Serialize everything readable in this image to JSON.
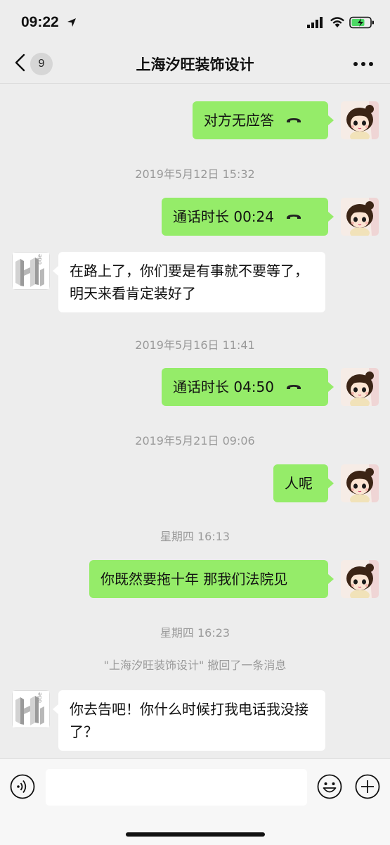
{
  "status_bar": {
    "time": "09:22"
  },
  "nav": {
    "back_count": "9",
    "title": "上海汐旺装饰设计"
  },
  "messages": {
    "m1": "对方无应答",
    "ts1": "2019年5月12日 15:32",
    "m2": "通话时长 00:24",
    "m3": "在路上了，你们要是有事就不要等了，明天来看肯定装好了",
    "ts2": "2019年5月16日 11:41",
    "m4": "通话时长 04:50",
    "ts3": "2019年5月21日 09:06",
    "m5": "人呢",
    "ts4": "星期四 16:13",
    "m6": "你既然要拖十年 那我们法院见",
    "ts5": "星期四 16:23",
    "recall": "\"上海汐旺装饰设计\" 撤回了一条消息",
    "m7": "你去告吧！你什么时候打我电话我没接了？"
  },
  "contact_avatar_text": "ode",
  "colors": {
    "sent_bubble": "#95ec69",
    "received_bubble": "#ffffff",
    "background": "#ededed"
  }
}
